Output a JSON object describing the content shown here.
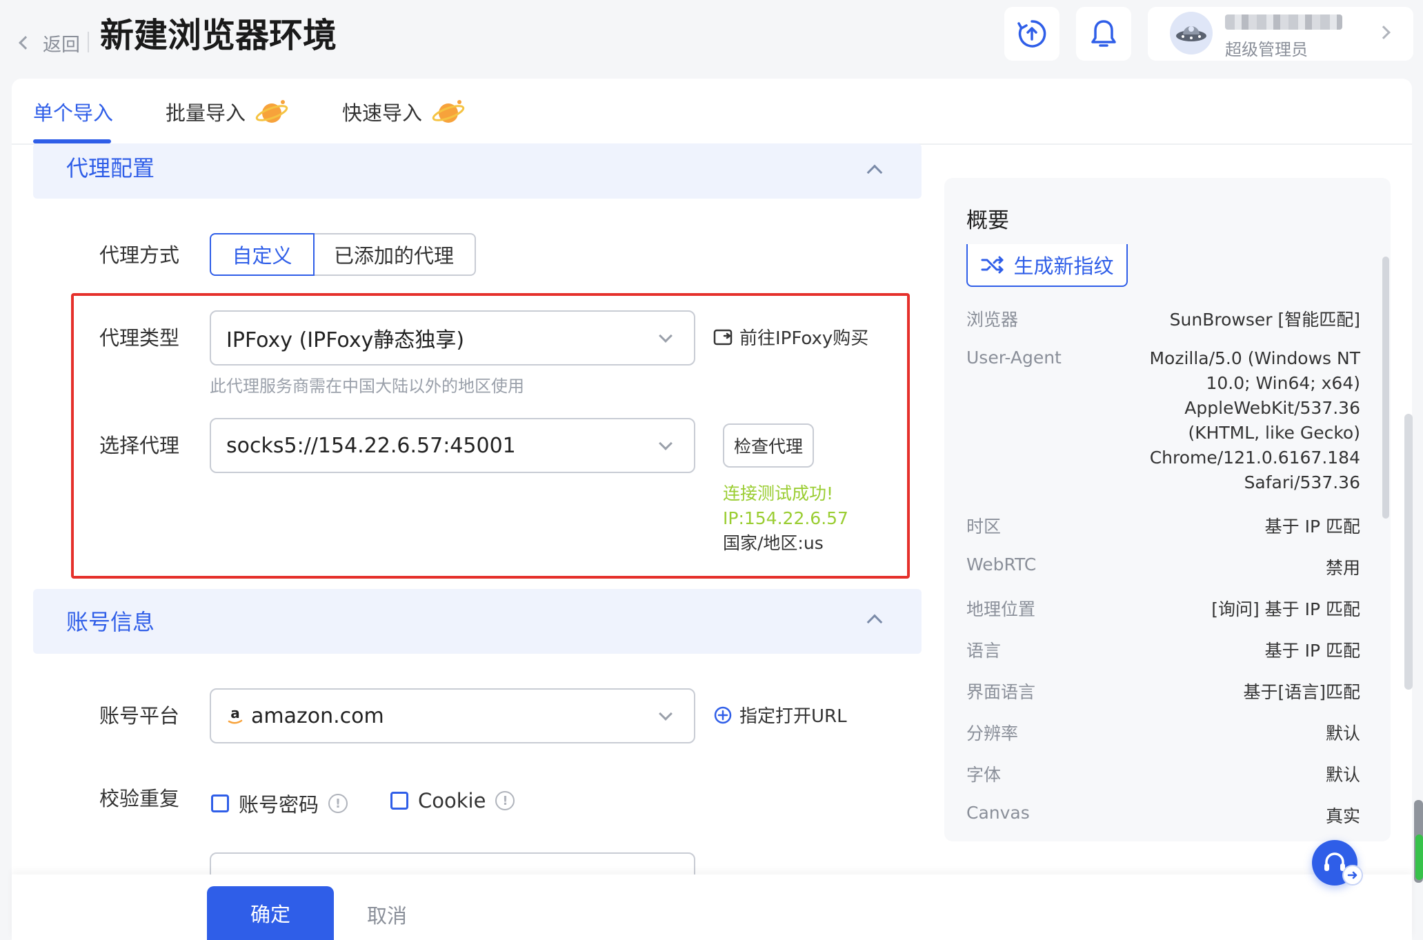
{
  "header": {
    "back_label": "返回",
    "title": "新建浏览器环境",
    "user_role": "超级管理员",
    "icons": [
      "sync-icon",
      "bell-icon",
      "avatar",
      "chevron-right-icon"
    ]
  },
  "tabs": [
    {
      "label": "单个导入",
      "active": true
    },
    {
      "label": "批量导入",
      "active": false
    },
    {
      "label": "快速导入",
      "active": false
    }
  ],
  "proxy_section": {
    "title": "代理配置",
    "mode_label": "代理方式",
    "mode_options": [
      "自定义",
      "已添加的代理"
    ],
    "mode_selected": "自定义",
    "type_label": "代理类型",
    "type_value": "IPFoxy (IPFoxy静态独享)",
    "buy_link": "前往IPFoxy购买",
    "hint": "此代理服务商需在中国大陆以外的地区使用",
    "select_label": "选择代理",
    "select_value": "socks5://154.22.6.57:45001",
    "check_button": "检查代理",
    "test_success": "连接测试成功!",
    "test_ip": "IP:154.22.6.57",
    "test_region": "国家/地区:us"
  },
  "account_section": {
    "title": "账号信息",
    "platform_label": "账号平台",
    "platform_value": "amazon.com",
    "open_url_link": "指定打开URL",
    "verify_label": "校验重复",
    "verify_options": [
      "账号密码",
      "Cookie"
    ]
  },
  "summary": {
    "title": "概要",
    "generate_button": "生成新指纹",
    "rows": [
      {
        "key": "浏览器",
        "value": "SunBrowser [智能匹配]"
      },
      {
        "key": "User-Agent",
        "value_lines": [
          "Mozilla/5.0 (Windows NT",
          "10.0; Win64; x64)",
          "AppleWebKit/537.36",
          "(KHTML, like Gecko)",
          "Chrome/121.0.6167.184",
          "Safari/537.36"
        ]
      },
      {
        "key": "时区",
        "value": "基于 IP 匹配"
      },
      {
        "key": "WebRTC",
        "value": "禁用"
      },
      {
        "key": "地理位置",
        "value": "[询问] 基于 IP 匹配"
      },
      {
        "key": "语言",
        "value": "基于 IP 匹配"
      },
      {
        "key": "界面语言",
        "value": "基于[语言]匹配"
      },
      {
        "key": "分辨率",
        "value": "默认"
      },
      {
        "key": "字体",
        "value": "默认"
      },
      {
        "key": "Canvas",
        "value": "真实"
      }
    ]
  },
  "footer": {
    "confirm": "确定",
    "cancel": "取消"
  },
  "colors": {
    "accent": "#2f5ee8",
    "highlight_box": "#e5302b",
    "success": "#9acd32"
  }
}
